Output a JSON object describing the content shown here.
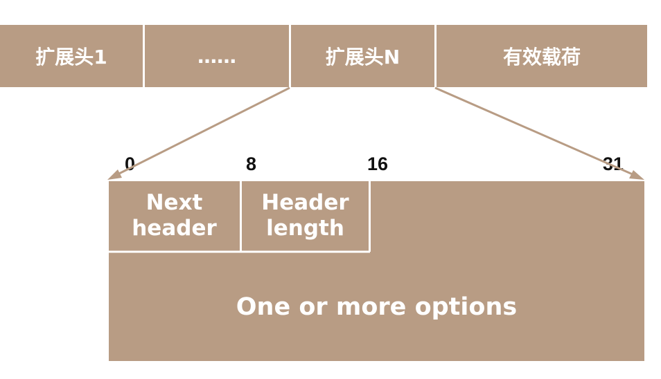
{
  "colors": {
    "block": "#b89c84",
    "block_text": "#ffffff",
    "label_text": "#111111",
    "divider": "#ffffff"
  },
  "packet": {
    "segments": [
      {
        "label": "扩展头1"
      },
      {
        "label": "……"
      },
      {
        "label": "扩展头N"
      },
      {
        "label": "有效载荷"
      }
    ]
  },
  "header": {
    "bit_labels": [
      "0",
      "8",
      "16",
      "31"
    ],
    "next_header": "Next header",
    "header_length": "Header length",
    "options": "One or more options"
  }
}
